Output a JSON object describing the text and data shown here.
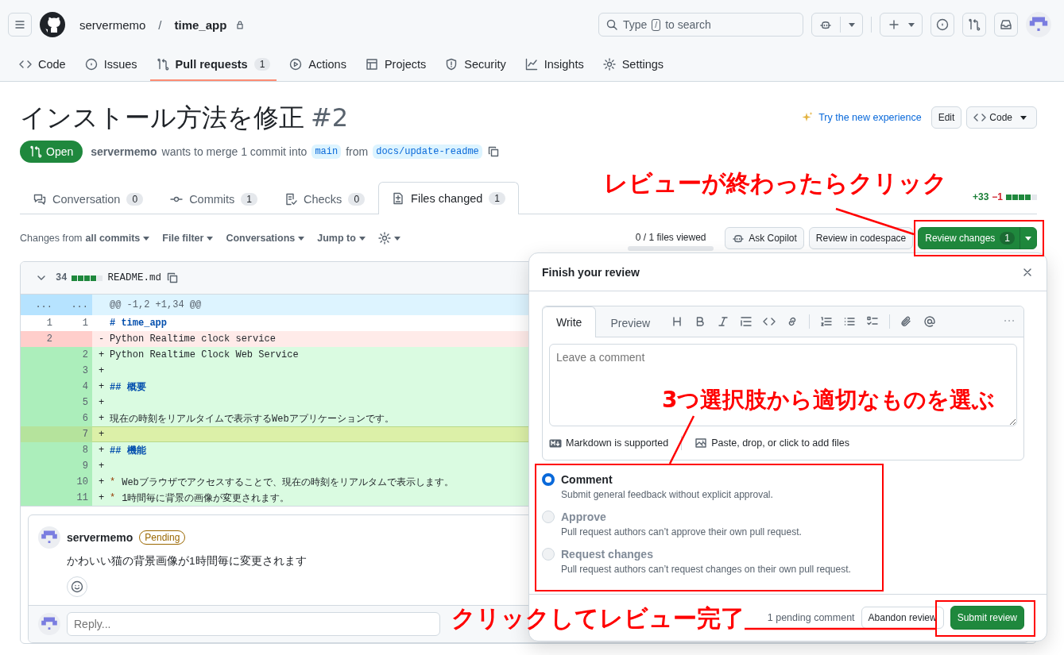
{
  "header": {
    "owner": "servermemo",
    "separator": "/",
    "repo": "time_app",
    "search": {
      "prefix": "Type",
      "key": "/",
      "suffix": "to search"
    }
  },
  "repo_nav": [
    {
      "label": "Code",
      "selected": false
    },
    {
      "label": "Issues",
      "selected": false
    },
    {
      "label": "Pull requests",
      "count": "1",
      "selected": true
    },
    {
      "label": "Actions",
      "selected": false
    },
    {
      "label": "Projects",
      "selected": false
    },
    {
      "label": "Security",
      "selected": false
    },
    {
      "label": "Insights",
      "selected": false
    },
    {
      "label": "Settings",
      "selected": false
    }
  ],
  "pr": {
    "title": "インストール方法を修正",
    "number": "#2",
    "try_link": "Try the new experience",
    "edit": "Edit",
    "code": "Code",
    "state": "Open",
    "author": "servermemo",
    "summary": "wants to merge 1 commit into",
    "base": "main",
    "from": "from",
    "head": "docs/update-readme"
  },
  "tabs": [
    {
      "label": "Conversation",
      "count": "0",
      "selected": false
    },
    {
      "label": "Commits",
      "count": "1",
      "selected": false
    },
    {
      "label": "Checks",
      "count": "0",
      "selected": false
    },
    {
      "label": "Files changed",
      "count": "1",
      "selected": true
    }
  ],
  "diffstat": {
    "additions": "+33",
    "deletions": "−1"
  },
  "toolbar": {
    "changes_from": "Changes from",
    "commits": "all commits",
    "file_filter": "File filter",
    "conversations": "Conversations",
    "jump_to": "Jump to",
    "files_viewed": "0 / 1 files viewed",
    "progress": {
      "level": 0
    },
    "ask_copilot": "Ask Copilot",
    "codespace": "Review in codespace",
    "review": "Review changes",
    "review_count": "1"
  },
  "file": {
    "lines_changed": "34",
    "name": "README.md",
    "hunk": {
      "old": "...",
      "new": "...",
      "text": "@@ -1,2 +1,34 @@"
    },
    "lines": [
      {
        "kind": "context",
        "old": "1",
        "new": "1",
        "heading": true,
        "text": "# time_app",
        "selected": false
      },
      {
        "kind": "deleted",
        "old": "2",
        "sign": "-",
        "heading": false,
        "text": "Python Realtime clock service",
        "selected": false
      },
      {
        "kind": "added",
        "new": "2",
        "sign": "+",
        "heading": false,
        "text": "Python Realtime Clock Web Service",
        "selected": false
      },
      {
        "kind": "added",
        "new": "3",
        "sign": "+",
        "selected": false
      },
      {
        "kind": "added",
        "new": "4",
        "sign": "+",
        "heading": true,
        "text": "## 概要",
        "selected": false
      },
      {
        "kind": "added",
        "new": "5",
        "sign": "+",
        "selected": false
      },
      {
        "kind": "added",
        "new": "6",
        "sign": "+",
        "heading": false,
        "text": "現在の時刻をリアルタイムで表示するWebアプリケーションです。",
        "selected": false
      },
      {
        "kind": "added",
        "new": "7",
        "sign": "+",
        "selected": true
      },
      {
        "kind": "added",
        "new": "8",
        "sign": "+",
        "heading": true,
        "text": "## 機能",
        "selected": false
      },
      {
        "kind": "added",
        "new": "9",
        "sign": "+",
        "selected": false
      },
      {
        "kind": "added",
        "new": "10",
        "sign": "+",
        "heading": false,
        "bullet": "*",
        "text": "Webブラウザでアクセスすることで、現在の時刻をリアルタムで表示します。",
        "selected": false
      },
      {
        "kind": "added",
        "new": "11",
        "sign": "+",
        "heading": false,
        "bullet": "*",
        "text": "1時間毎に背景の画像が変更されます。",
        "selected": false
      }
    ]
  },
  "comment": {
    "author": "servermemo",
    "badge": "Pending",
    "body": "かわいい猫の背景画像が1時間毎に変更されます",
    "reply_placeholder": "Reply..."
  },
  "review_dialog": {
    "title": "Finish your review",
    "tabs": [
      {
        "label": "Write",
        "selected": true
      },
      {
        "label": "Preview",
        "selected": false
      }
    ],
    "placeholder": "Leave a comment",
    "markdown_note": "Markdown is supported",
    "attach_note": "Paste, drop, or click to add files",
    "options": [
      {
        "label": "Comment",
        "description": "Submit general feedback without explicit approval.",
        "selected": true,
        "disabled": false
      },
      {
        "label": "Approve",
        "description": "Pull request authors can’t approve their own pull request.",
        "selected": false,
        "disabled": true
      },
      {
        "label": "Request changes",
        "description": "Pull request authors can’t request changes on their own pull request.",
        "selected": false,
        "disabled": true
      }
    ],
    "pending": "1 pending comment",
    "abandon": "Abandon review",
    "submit": "Submit review"
  },
  "annotations": [
    {
      "text": "レビューが終わったらクリック"
    },
    {
      "text": "3つ選択肢から適切なものを選ぶ"
    },
    {
      "text": "クリックしてレビュー完了"
    }
  ]
}
